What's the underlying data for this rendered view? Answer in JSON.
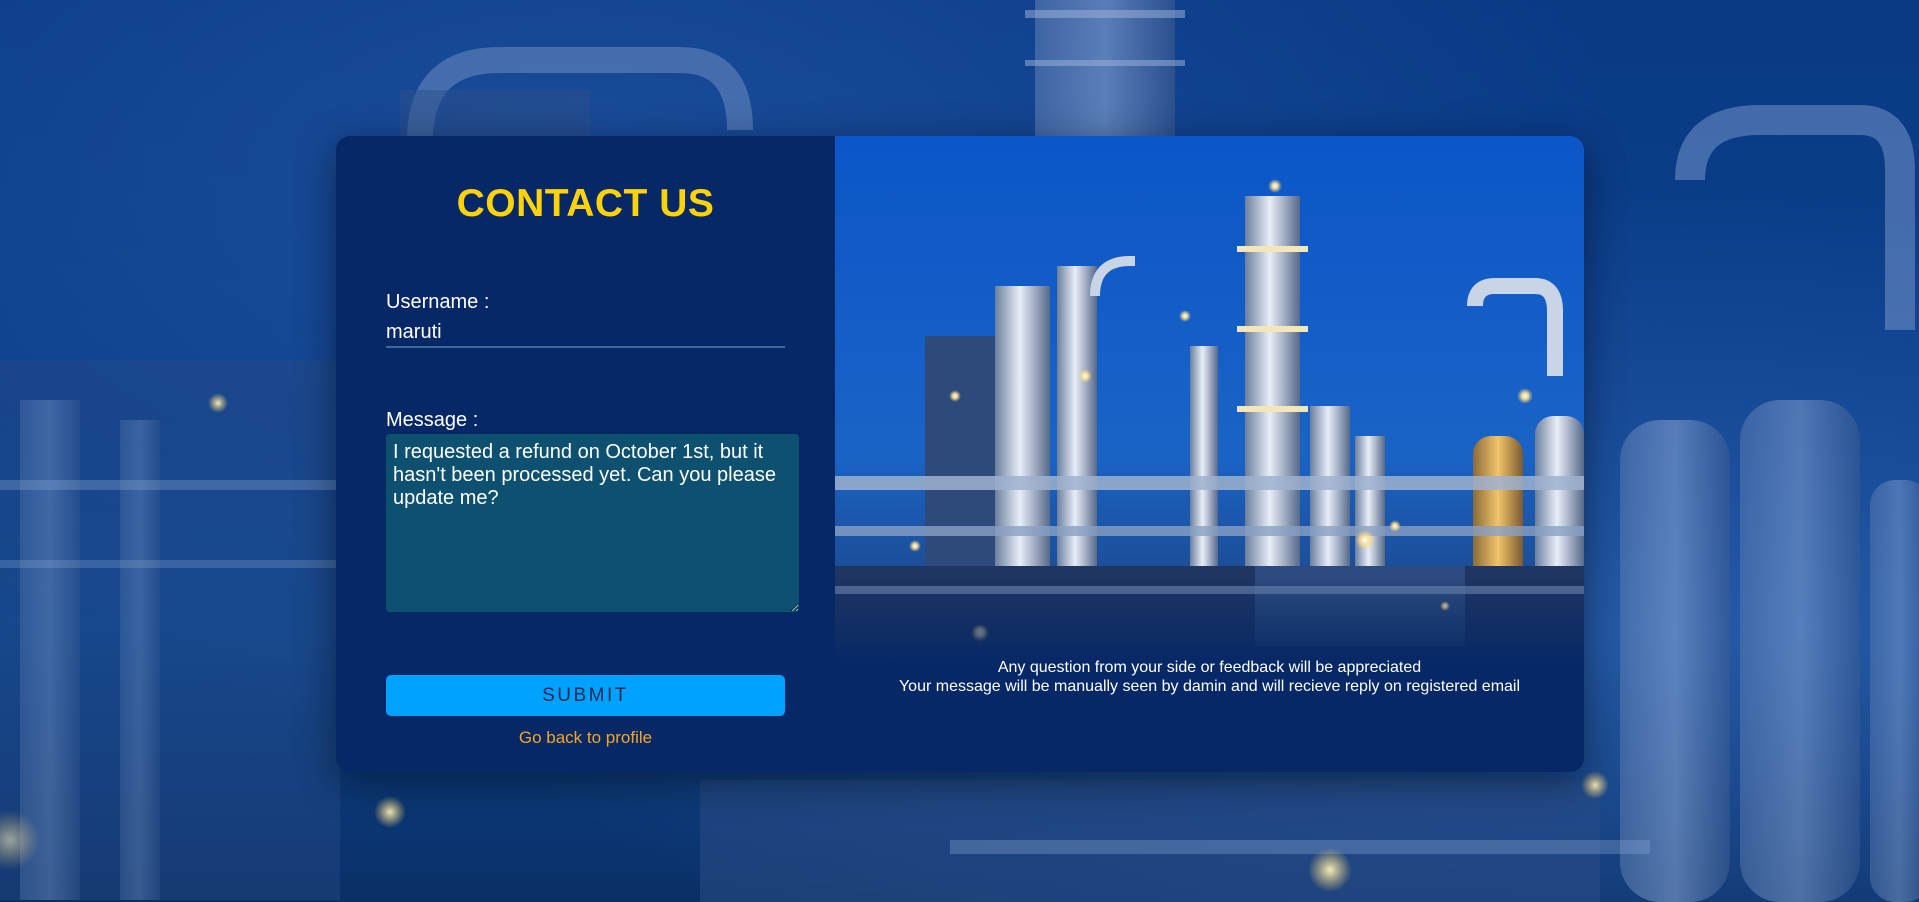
{
  "contact": {
    "title": "CONTACT US",
    "username_label": "Username :",
    "username_value": "maruti",
    "message_label": "Message :",
    "message_value": "I requested a refund on October 1st, but it hasn't been processed yet. Can you please update me?",
    "submit_label": "SUBMIT",
    "back_link": "Go back to profile"
  },
  "info": {
    "line1": "Any question from your side or feedback will be appreciated",
    "line2": "Your message will be manually seen by damin and will recieve reply on registered email"
  },
  "colors": {
    "title": "#ffd20a",
    "submit_bg": "#00a2ff",
    "link": "#f5a623",
    "card_bg": "#062866",
    "message_bg": "#0e506f"
  },
  "images": {
    "background": "refinery-night-blurred",
    "side_photo": "refinery-night-photo"
  }
}
